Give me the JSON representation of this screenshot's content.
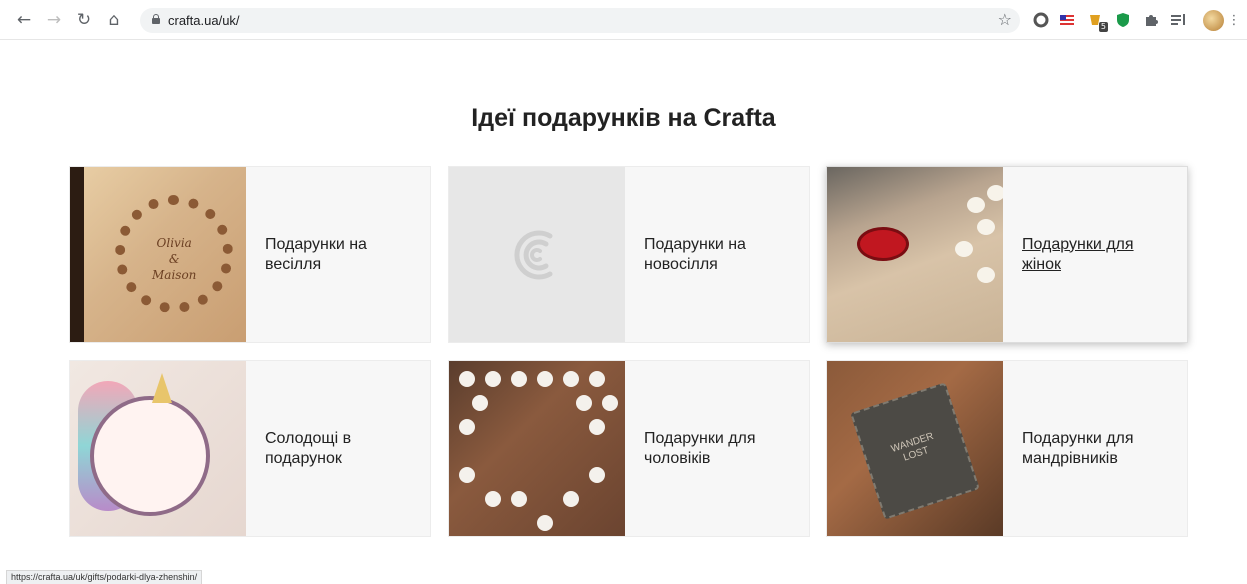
{
  "browser": {
    "url": "crafta.ua/uk/",
    "back_icon": "arrow-left-icon",
    "forward_icon": "arrow-right-icon",
    "reload_icon": "reload-icon",
    "home_icon": "home-icon",
    "extension_badge": "5"
  },
  "page": {
    "title": "Ідеї подарунків на Crafta"
  },
  "cards": [
    {
      "label": "Подарунки на весілля"
    },
    {
      "label": "Подарунки на новосілля"
    },
    {
      "label": "Подарунки для жінок"
    },
    {
      "label": "Солодощі в подарунок"
    },
    {
      "label": "Подарунки для чоловіків"
    },
    {
      "label": "Подарунки для мандрівників"
    }
  ],
  "thumb_text": {
    "wedding": "Olivia\n&\nMaison",
    "travel": "WANDER\nLOST"
  },
  "status_bar": {
    "link": "https://crafta.ua/uk/gifts/podarki-dlya-zhenshin/"
  },
  "colors": {
    "page_bg": "#ffffff",
    "card_bg": "#f7f7f7",
    "text": "#222222"
  }
}
